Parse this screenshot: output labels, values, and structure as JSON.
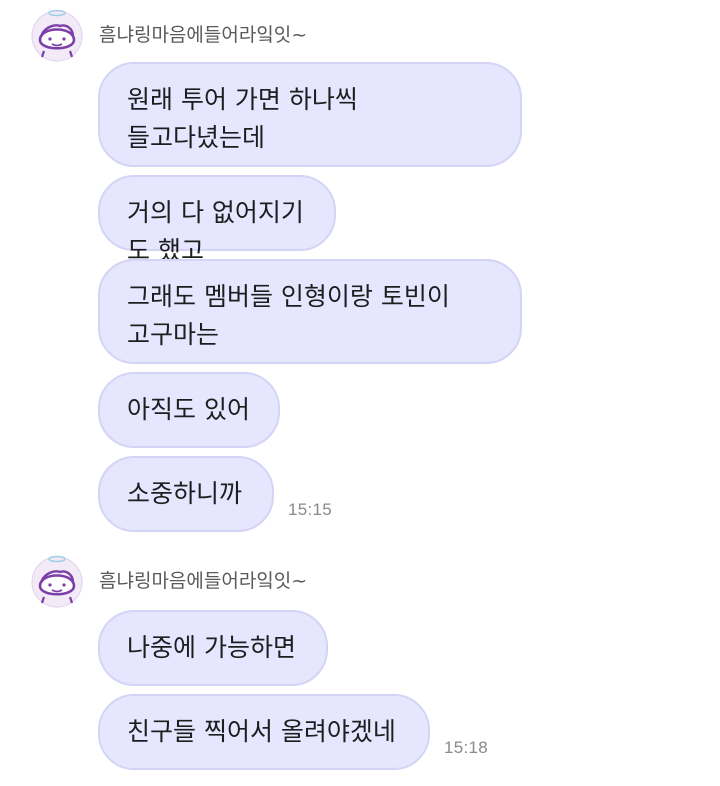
{
  "chat": {
    "groups": [
      {
        "sender": "흠냐링마음에들어라잌잇~",
        "messages": [
          "원래 투어 가면 하나씩\n들고다녔는데",
          "거의 다 없어지기도 했고",
          "그래도 멤버들 인형이랑 토빈이\n고구마는",
          "아직도 있어",
          "소중하니까"
        ],
        "time": "15:15"
      },
      {
        "sender": "흠냐링마음에들어라잌잇~",
        "messages": [
          "나중에 가능하면",
          "친구들 찍어서 올려야겠네"
        ],
        "time": "15:18"
      }
    ]
  },
  "colors": {
    "bubble_bg": "#e6e6ff",
    "bubble_border": "#d4d4f6",
    "avatar_accent": "#7a3fa8"
  },
  "icons": {
    "avatar": "cartoon-face-with-halo"
  }
}
